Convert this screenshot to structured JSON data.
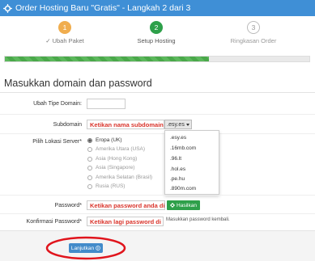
{
  "window": {
    "title": "Order Hosting Baru \"Gratis\" - Langkah 2 dari 3"
  },
  "steps": [
    {
      "number": "1",
      "label": "Ubah Paket",
      "status": "done",
      "color": "#f0ad4e"
    },
    {
      "number": "2",
      "label": "Setup Hosting",
      "status": "active",
      "color": "#2ea04a"
    },
    {
      "number": "3",
      "label": "Ringkasan Order",
      "status": "pending",
      "color": "#bbbbbb"
    }
  ],
  "progress": {
    "percent": 67,
    "color": "#5cb85c"
  },
  "form": {
    "heading": "Masukkan domain dan password",
    "domain_type": {
      "label": "Ubah Tipe Domain:",
      "value": ""
    },
    "subdomain": {
      "label": "Subdomain",
      "placeholder": "Ketikan nama subdomain anda",
      "selected_suffix": ".esy.es",
      "options": [
        ".esy.es",
        ".16mb.com",
        ".96.lt",
        ".hol.es",
        ".pe.hu",
        ".890m.com"
      ]
    },
    "server_location": {
      "label": "Pilih Lokasi Server*",
      "options": [
        {
          "label": "Eropa (UK)",
          "checked": true
        },
        {
          "label": "Amerika Utara (USA)",
          "checked": false
        },
        {
          "label": "Asia (Hong Kong)",
          "checked": false
        },
        {
          "label": "Asia (Singapore)",
          "checked": false
        },
        {
          "label": "Amerika Selatan (Brasil)",
          "checked": false
        },
        {
          "label": "Rusia (RUS)",
          "checked": false
        }
      ]
    },
    "password": {
      "label": "Password*",
      "placeholder": "Ketikan password anda di sini",
      "generate_button": "Hasilkan"
    },
    "password_confirm": {
      "label": "Konfirmasi Password*",
      "placeholder": "Ketikan lagi password di sini",
      "help": "Masukkan password kembali."
    }
  },
  "footer": {
    "continue_button": "Lanjutkan",
    "highlight_color": "#e0141c"
  },
  "colors": {
    "titlebar": "#3f8fd6",
    "accent_red": "#d9342b",
    "primary_blue": "#428bca"
  }
}
